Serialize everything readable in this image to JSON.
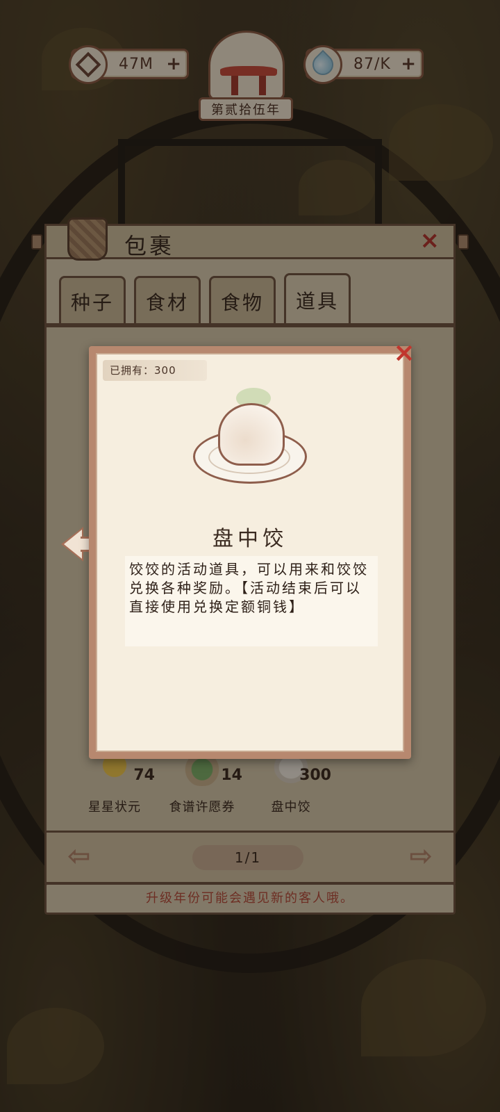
{
  "resources": {
    "coins": {
      "value": "47M",
      "icon": "copper-coin-icon"
    },
    "spirit": {
      "value": "87/K",
      "icon": "water-drop-icon"
    },
    "plus_label": "+"
  },
  "year_label": "第贰拾伍年",
  "bag": {
    "title": "包裹",
    "close_label": "×",
    "tabs": [
      {
        "label": "种子",
        "active": false
      },
      {
        "label": "食材",
        "active": false
      },
      {
        "label": "食物",
        "active": false
      },
      {
        "label": "道具",
        "active": true
      }
    ],
    "items": [
      {
        "name": "星星状元",
        "count": "74"
      },
      {
        "name": "食谱许愿券",
        "count": "14"
      },
      {
        "name": "盘中饺",
        "count": "300"
      }
    ],
    "pagination": {
      "page": "1/1",
      "prev_label": "⇦",
      "next_label": "⇨"
    }
  },
  "tip_text": "升级年份可能会遇见新的客人哦。",
  "detail": {
    "owned_label": "已拥有：",
    "owned_count": "300",
    "close_label": "×",
    "item_name": "盘中饺",
    "description": "饺饺的活动道具，可以用来和饺饺兑换各种奖励。【活动结束后可以直接使用兑换定额铜钱】"
  },
  "colors": {
    "panel": "#d9cbb0",
    "card": "#f6eedf",
    "border": "#6e5440",
    "accent_red": "#c1362e",
    "tip_text": "#b64a3a"
  }
}
